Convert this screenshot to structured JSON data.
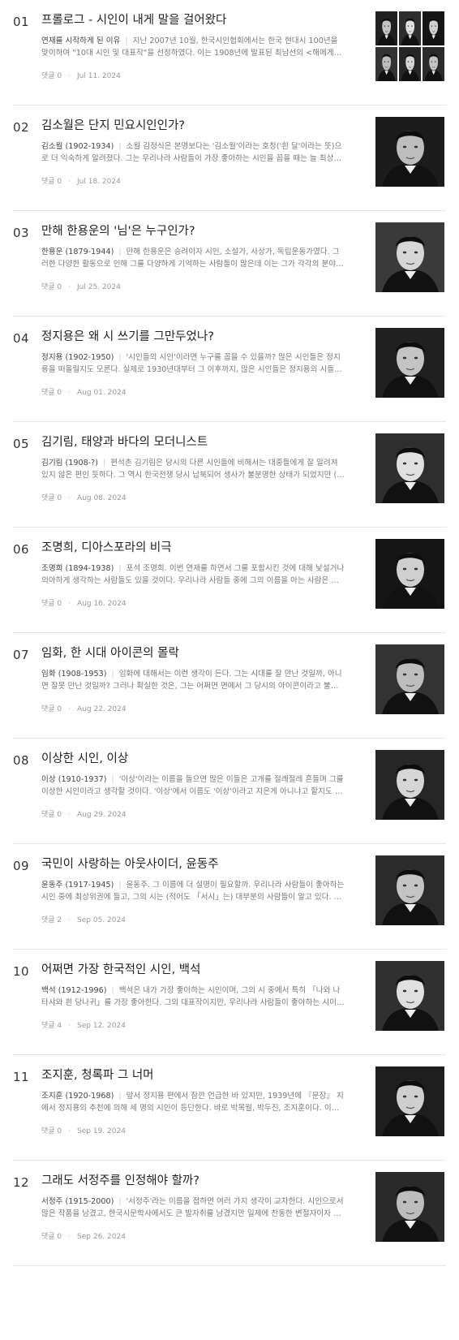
{
  "posts": [
    {
      "num": "01",
      "title": "프롤로그 - 시인이 내게 말을 걸어왔다",
      "who": "연재를 시작하게 된 이유",
      "desc": "지난 2007년 10월, 한국시인협회에서는 한국 현대시 100년을 맞이하여 \"10대 시인 및 대표작\"을 선정하였다. 이는 1908년에 발표된 최남선의 <해에게서 소년에게>...",
      "comments": "댓글 0",
      "date": "Jul 11. 2024"
    },
    {
      "num": "02",
      "title": "김소월은 단지 민요시인인가?",
      "who": "김소월 (1902-1934)",
      "desc": "소월 김정식은 본명보다는 '김소월'이라는 호칭('흰 달'이라는 뜻)으로 더 익숙하게 알려졌다. 그는 우리나라 사람들이 가장 좋아하는 시인을 꼽을 때는 늘 최상위권에 있다...",
      "comments": "댓글 0",
      "date": "Jul 18. 2024"
    },
    {
      "num": "03",
      "title": "만해 한용운의 '님'은 누구인가?",
      "who": "한용운 (1879-1944)",
      "desc": "만해 한용운은 승려이자 시인, 소설가, 사상가, 독립운동가였다. 그러한 다양한 활동으로 인해 그를 다양하게 기억하는 사람들이 많은데 이는 그가 각각의 분야에서 두드...",
      "comments": "댓글 0",
      "date": "Jul 25. 2024"
    },
    {
      "num": "04",
      "title": "정지용은 왜 시 쓰기를 그만두었나?",
      "who": "정지용 (1902-1950)",
      "desc": "'시인들의 시인'이라면 누구를 꼽을 수 있을까? 많은 시인들은 정지용을 떠올릴지도 모른다. 실제로 1930년대부터 그 이후까지, 많은 시인들은 정지용의 시들을 좋아했고...",
      "comments": "댓글 0",
      "date": "Aug 01. 2024"
    },
    {
      "num": "05",
      "title": "김기림, 태양과 바다의 모더니스트",
      "who": "김기림 (1908-?)",
      "desc": "편석촌 김기림은 당시의 다른 시인들에 비해서는 대중들에게 잘 알려져 있지 않은 편인 듯하다. 그 역시 한국전쟁 당시 납북되어 생사가 불분명한 상태가 되었지만 (그래서 사...",
      "comments": "댓글 0",
      "date": "Aug 08. 2024"
    },
    {
      "num": "06",
      "title": "조명희, 디아스포라의 비극",
      "who": "조명희 (1894-1938)",
      "desc": "포석 조명희. 이번 연재를 하면서 그를 포함시킨 것에 대해 낯설거나 의아하게 생각하는 사람들도 있을 것이다. 우리나라 사람들 중에 그의 이름을 아는 사람은 얼마나 될...",
      "comments": "댓글 0",
      "date": "Aug 16. 2024"
    },
    {
      "num": "07",
      "title": "임화, 한 시대 아이콘의 몰락",
      "who": "임화 (1908-1953)",
      "desc": "임화에 대해서는 이런 생각이 든다. 그는 시대를 잘 만난 것일까, 아니면 잘못 만난 것일까? 그러나 확실한 것은, 그는 어쩌면 면에서 그 당시의 아이콘이라고 불릴 만했다는 것...",
      "comments": "댓글 0",
      "date": "Aug 22. 2024"
    },
    {
      "num": "08",
      "title": "이상한 시인, 이상",
      "who": "이상 (1910-1937)",
      "desc": "'이상'이라는 이름을 들으면 많은 이들은 고개를 절레절레 흔들며 그를 이상한 시인이라고 생각할 것이다. '이상'에서 이름도 '이상'이라고 지은게 아니냐고 할지도 모르겠다...",
      "comments": "댓글 0",
      "date": "Aug 29. 2024"
    },
    {
      "num": "09",
      "title": "국민이 사랑하는 아웃사이더, 윤동주",
      "who": "윤동주 (1917-1945)",
      "desc": "윤동주. 그 이름에 더 설명이 필요할까. 우리나라 사람들이 좋아하는 시인 중에 최상위권에 들고, 그의 시는 (적어도 「서시」는) 대부분의 사람들이 알고 있다. 학교에서...",
      "comments": "댓글 2",
      "date": "Sep 05. 2024"
    },
    {
      "num": "10",
      "title": "어쩌면 가장 한국적인 시인, 백석",
      "who": "백석 (1912-1996)",
      "desc": "백석은 내가 가장 좋아하는 시인이며, 그의 시 중에서 특히 「나와 나타샤와 흰 당나귀」를 가장 좋아한다. 그의 대표작이지만, 우리나라 사람들이 좋아하는 시이기도 하다...",
      "comments": "댓글 4",
      "date": "Sep 12. 2024"
    },
    {
      "num": "11",
      "title": "조지훈, 청록파 그 너머",
      "who": "조지훈 (1920-1968)",
      "desc": "앞서 정지용 편에서 잠깐 언급한 바 있지만, 1939년에 『문장』 지에서 정지용의 추천에 의해 세 명의 시인이 등단한다. 바로 박목월, 박두진, 조지훈이다. 이들은 따로 동...",
      "comments": "댓글 0",
      "date": "Sep 19. 2024"
    },
    {
      "num": "12",
      "title": "그래도 서정주를 인정해야 할까?",
      "who": "서정주 (1915-2000)",
      "desc": "'서정주'라는 이름을 접하면 여러 가지 생각이 교차한다. 시인으로서 많은 작품을 남겼고, 한국시문학사에서도 큰 발자취를 남겼지만 일제에 찬동한 변절자이자 전두환...",
      "comments": "댓글 0",
      "date": "Sep 26. 2024"
    }
  ],
  "thumbs": [
    "portrait-collage",
    "portrait",
    "portrait",
    "portrait",
    "portrait",
    "portrait",
    "portrait",
    "portrait",
    "portrait",
    "portrait",
    "portrait",
    "portrait"
  ]
}
